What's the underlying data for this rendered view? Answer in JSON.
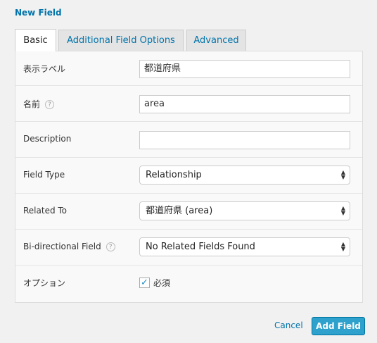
{
  "dialog": {
    "title": "New Field"
  },
  "tabs": [
    {
      "label": "Basic"
    },
    {
      "label": "Additional Field Options"
    },
    {
      "label": "Advanced"
    }
  ],
  "fields": {
    "display_label": {
      "label": "表示ラベル",
      "value": "都道府県"
    },
    "name": {
      "label": "名前",
      "value": "area"
    },
    "description": {
      "label": "Description",
      "value": ""
    },
    "field_type": {
      "label": "Field Type",
      "selected": "Relationship"
    },
    "related_to": {
      "label": "Related To",
      "selected": "都道府県 (area)"
    },
    "bidirectional": {
      "label": "Bi-directional Field",
      "selected": "No Related Fields Found"
    },
    "options": {
      "label": "オプション",
      "checkbox_label": "必須",
      "checked": true
    }
  },
  "help_glyph": "?",
  "select_arrow": "▲▼",
  "footer": {
    "cancel_label": "Cancel",
    "add_label": "Add Field"
  },
  "colors": {
    "link": "#0073aa",
    "primary_button": "#2ea2cc"
  }
}
